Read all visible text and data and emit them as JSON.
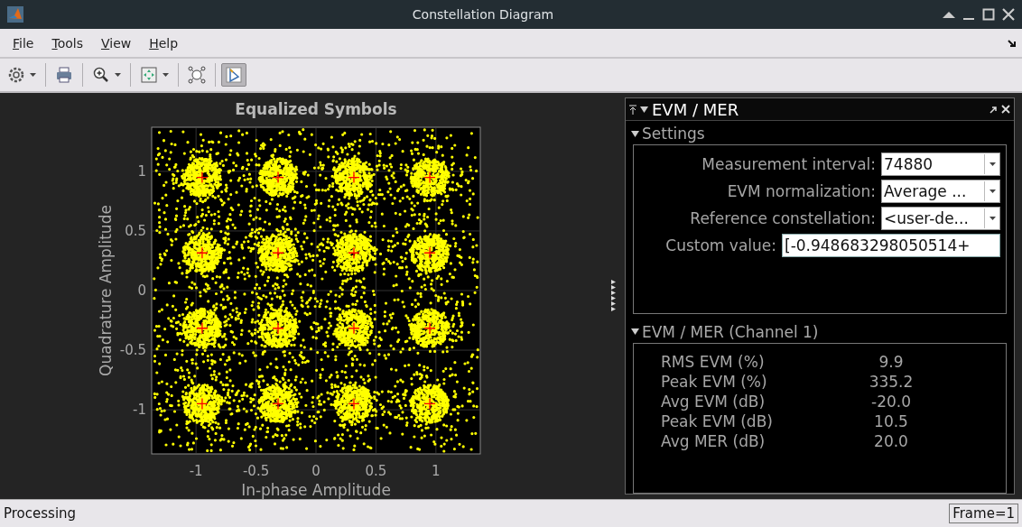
{
  "window": {
    "title": "Constellation Diagram"
  },
  "menu": [
    {
      "label": "File"
    },
    {
      "label": "Tools"
    },
    {
      "label": "View"
    },
    {
      "label": "Help"
    }
  ],
  "toolbar": [
    {
      "kind": "settings",
      "menu": true,
      "selected": false
    },
    {
      "kind": "print",
      "menu": false,
      "selected": false
    },
    {
      "kind": "zoom",
      "menu": true,
      "selected": false
    },
    {
      "kind": "fit",
      "menu": true,
      "selected": false
    },
    {
      "kind": "constellation",
      "menu": false,
      "selected": false
    },
    {
      "kind": "measure",
      "menu": false,
      "selected": true
    }
  ],
  "plot": {
    "chart_data": {
      "type": "scatter",
      "title": "Equalized Symbols",
      "xlabel": "In-phase Amplitude",
      "ylabel": "Quadrature Amplitude",
      "x": [
        -0.949,
        -0.316,
        0.316,
        0.949,
        -0.949,
        -0.316,
        0.316,
        0.949,
        -0.949,
        -0.316,
        0.316,
        0.949,
        -0.949,
        -0.316,
        0.316,
        0.949
      ],
      "grid": true,
      "series": [
        {
          "color": "#ff0000",
          "values": [
            0.949,
            0.949,
            0.949,
            0.949,
            0.316,
            0.316,
            0.316,
            0.316,
            -0.316,
            -0.316,
            -0.316,
            -0.316,
            -0.949,
            -0.949,
            -0.949,
            -0.949
          ]
        }
      ],
      "xlim": [
        -1.37,
        1.37
      ],
      "ylim": [
        -1.37,
        1.37
      ],
      "xticks": [
        {
          "value": -1,
          "label": "-1"
        },
        {
          "value": -0.5,
          "label": "-0.5"
        },
        {
          "value": 0,
          "label": "0"
        },
        {
          "value": 0.5,
          "label": "0.5"
        },
        {
          "value": 1,
          "label": "1"
        }
      ],
      "yticks": [
        {
          "value": -1,
          "label": "-1"
        },
        {
          "value": -0.5,
          "label": "-0.5"
        },
        {
          "value": 0,
          "label": "0"
        },
        {
          "value": 0.5,
          "label": "0.5"
        },
        {
          "value": 1,
          "label": "1"
        }
      ]
    }
  },
  "panel": {
    "title": "EVM / MER",
    "settings": {
      "title": "Settings",
      "expanded": true,
      "rows": [
        {
          "kind": "dropdown",
          "label": "Measurement interval:",
          "value": "74880"
        },
        {
          "kind": "dropdown",
          "label": "EVM normalization:",
          "value": "Average ..."
        },
        {
          "kind": "dropdown",
          "label": "Reference constellation:",
          "value": "<user-de..."
        },
        {
          "kind": "text-field",
          "label": "Custom value:",
          "value": "[-0.948683298050514+"
        }
      ]
    },
    "results": {
      "title": "EVM / MER (Channel 1)",
      "expanded": true,
      "rows": [
        {
          "label": "RMS EVM (%)",
          "value": "9.9"
        },
        {
          "label": "Peak EVM (%)",
          "value": "335.2"
        },
        {
          "label": "Avg EVM (dB)",
          "value": "-20.0"
        },
        {
          "label": "Peak EVM (dB)",
          "value": "10.5"
        },
        {
          "label": "Avg MER (dB)",
          "value": "20.0"
        }
      ]
    }
  },
  "status_bar": {
    "message": "Processing",
    "frame": "Frame=1"
  }
}
